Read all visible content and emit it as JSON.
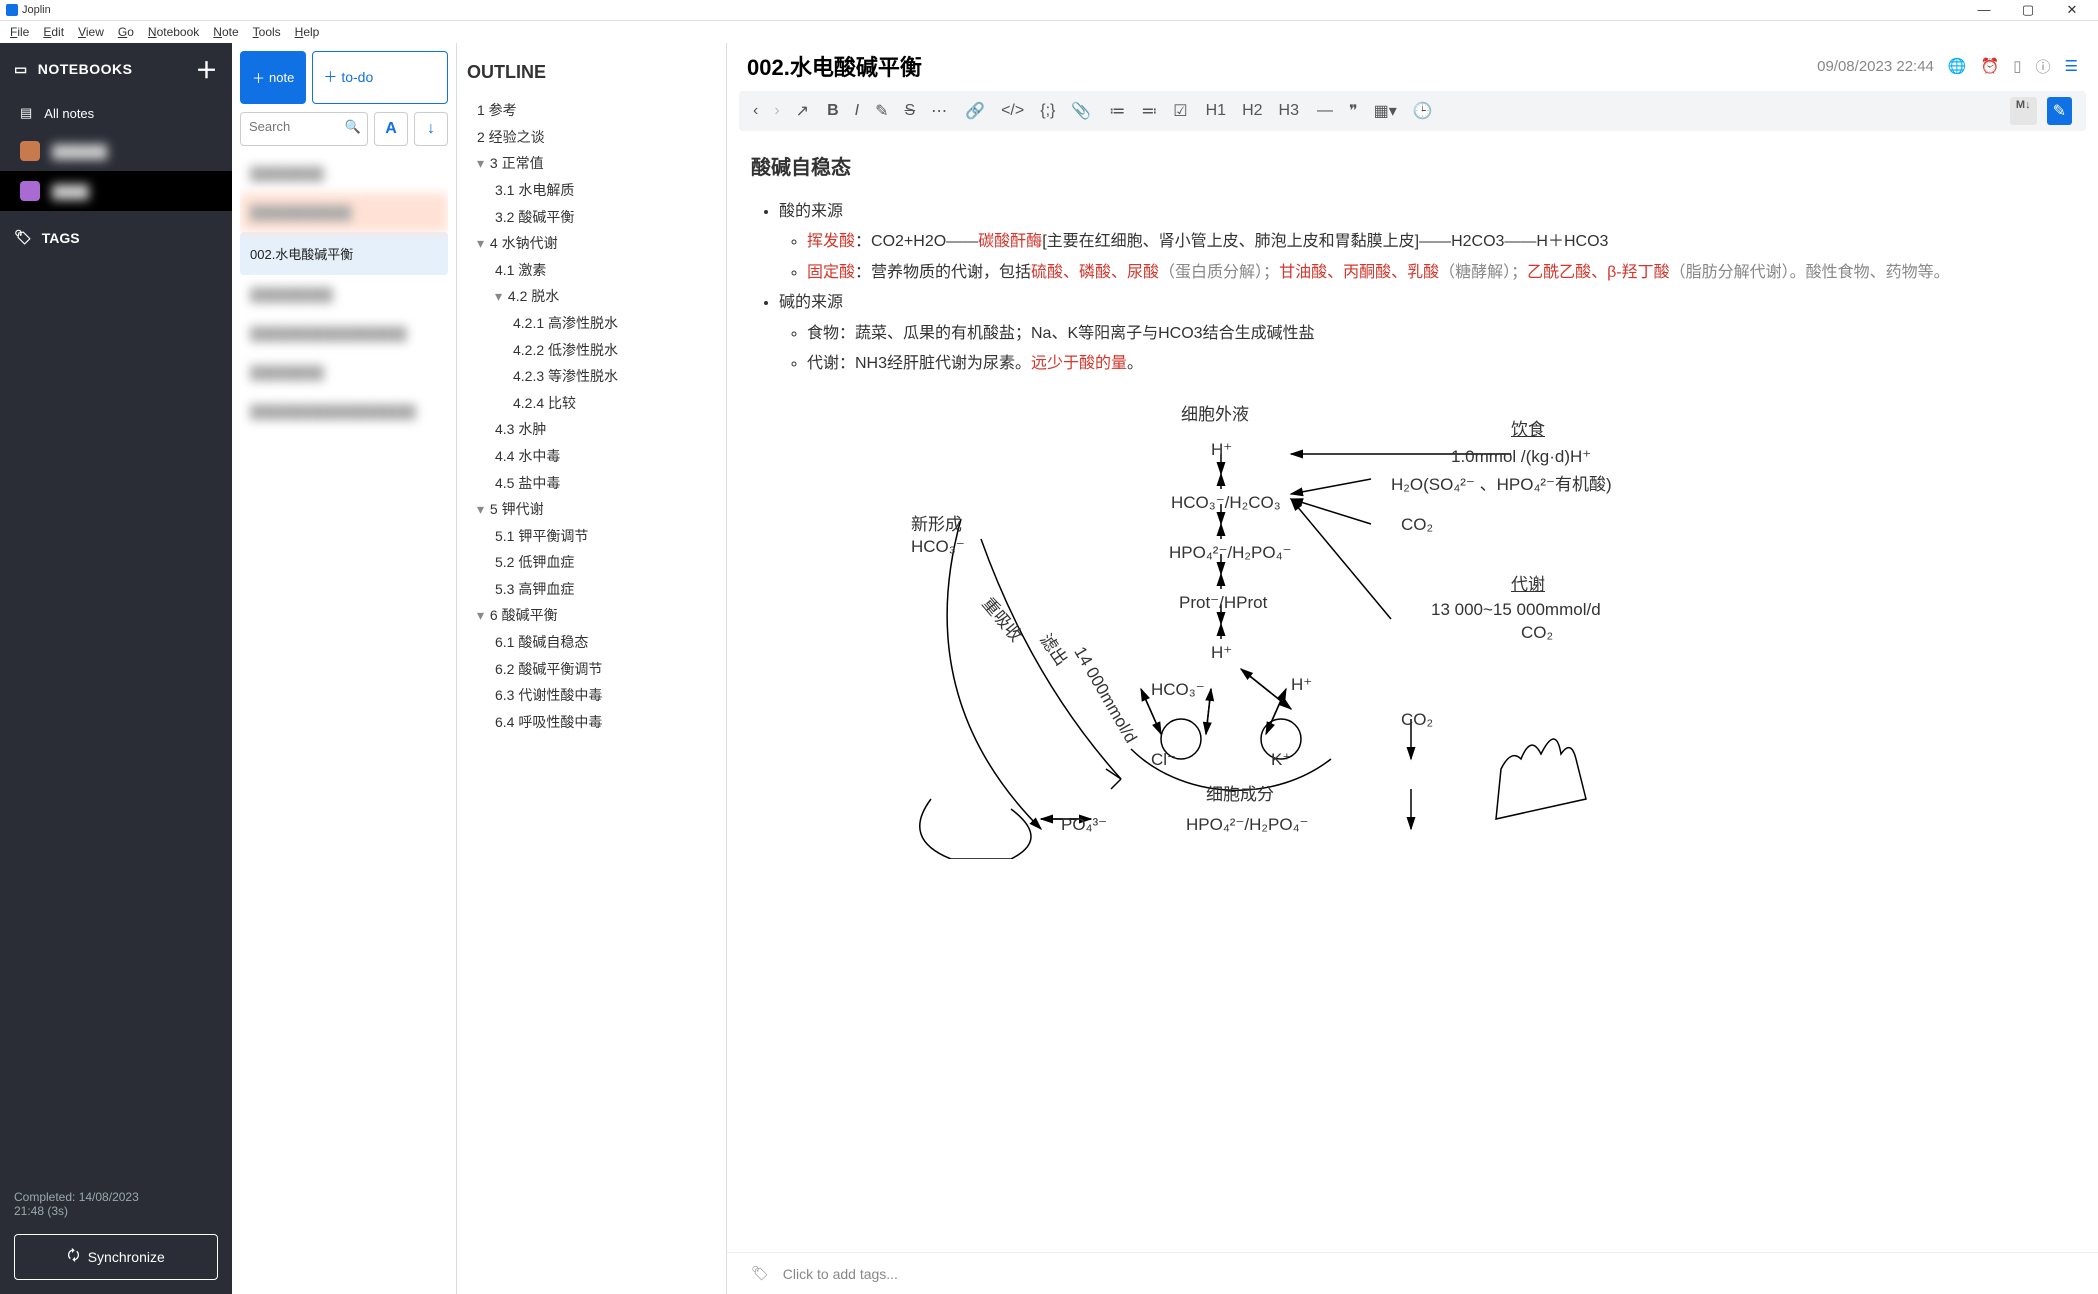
{
  "app": {
    "title": "Joplin"
  },
  "menubar": [
    "File",
    "Edit",
    "View",
    "Go",
    "Notebook",
    "Note",
    "Tools",
    "Help"
  ],
  "window_controls": {
    "min": "—",
    "max": "▢",
    "close": "✕"
  },
  "sidebar": {
    "notebooks_label": "NOTEBOOKS",
    "all_notes": "All notes",
    "nb1": "██████",
    "nb2": "████",
    "tags_label": "TAGS",
    "status_line1": "Completed: 14/08/2023",
    "status_line2": "21:48 (3s)",
    "sync_label": "Synchronize"
  },
  "notelist": {
    "note_btn": "note",
    "todo_btn": "to-do",
    "search_placeholder": "Search",
    "sort_btn": "A",
    "items": [
      {
        "label": "████████",
        "blur": true
      },
      {
        "label": "███████████",
        "blur": true,
        "hl": true
      },
      {
        "label": "002.水电酸碱平衡",
        "sel": true
      },
      {
        "label": "█████████",
        "blur": true
      },
      {
        "label": "█████████████████",
        "blur": true
      },
      {
        "label": "████████",
        "blur": true
      },
      {
        "label": "██████████████████",
        "blur": true
      }
    ]
  },
  "outline": {
    "title": "OUTLINE",
    "items": [
      {
        "indent": 0,
        "tw": "",
        "text": "1 参考"
      },
      {
        "indent": 0,
        "tw": "",
        "text": "2 经验之谈"
      },
      {
        "indent": 0,
        "tw": "▾",
        "text": "3 正常值"
      },
      {
        "indent": 1,
        "tw": "",
        "text": "3.1 水电解质"
      },
      {
        "indent": 1,
        "tw": "",
        "text": "3.2 酸碱平衡"
      },
      {
        "indent": 0,
        "tw": "▾",
        "text": "4 水钠代谢"
      },
      {
        "indent": 1,
        "tw": "",
        "text": "4.1 激素"
      },
      {
        "indent": 1,
        "tw": "▾",
        "text": "4.2 脱水"
      },
      {
        "indent": 2,
        "tw": "",
        "text": "4.2.1 高渗性脱水"
      },
      {
        "indent": 2,
        "tw": "",
        "text": "4.2.2 低渗性脱水"
      },
      {
        "indent": 2,
        "tw": "",
        "text": "4.2.3 等渗性脱水"
      },
      {
        "indent": 2,
        "tw": "",
        "text": "4.2.4 比较"
      },
      {
        "indent": 1,
        "tw": "",
        "text": "4.3 水肿"
      },
      {
        "indent": 1,
        "tw": "",
        "text": "4.4 水中毒"
      },
      {
        "indent": 1,
        "tw": "",
        "text": "4.5 盐中毒"
      },
      {
        "indent": 0,
        "tw": "▾",
        "text": "5 钾代谢"
      },
      {
        "indent": 1,
        "tw": "",
        "text": "5.1 钾平衡调节"
      },
      {
        "indent": 1,
        "tw": "",
        "text": "5.2 低钾血症"
      },
      {
        "indent": 1,
        "tw": "",
        "text": "5.3 高钾血症"
      },
      {
        "indent": 0,
        "tw": "▾",
        "text": "6 酸碱平衡"
      },
      {
        "indent": 1,
        "tw": "",
        "text": "6.1 酸碱自稳态"
      },
      {
        "indent": 1,
        "tw": "",
        "text": "6.2 酸碱平衡调节"
      },
      {
        "indent": 1,
        "tw": "",
        "text": "6.3 代谢性酸中毒"
      },
      {
        "indent": 1,
        "tw": "",
        "text": "6.4 呼吸性酸中毒"
      }
    ]
  },
  "editor": {
    "title": "002.水电酸碱平衡",
    "timestamp": "09/08/2023 22:44",
    "toolbar_h": [
      "H1",
      "H2",
      "H3"
    ],
    "md_label": "M↓"
  },
  "content": {
    "h3": "酸碱自稳态",
    "b1": "酸的来源",
    "line1_a": "挥发酸",
    "line1_b": "：CO2+H2O——",
    "line1_c": "碳酸酐酶",
    "line1_d": "[主要在红细胞、肾小管上皮、肺泡上皮和胃黏膜上皮]——H2CO3——H＋HCO3",
    "line2_a": "固定酸",
    "line2_b": "：营养物质的代谢，包括",
    "line2_c": "硫酸、磷酸、尿酸",
    "line2_d": "（蛋白质分解）；",
    "line2_e": "甘油酸、丙酮酸、乳酸",
    "line2_f": "（糖酵解）；",
    "line2_g": "乙酰乙酸、β-羟丁酸",
    "line2_h": "（脂肪分解代谢）。酸性食物、药物等。",
    "b2": "碱的来源",
    "line3": "食物：蔬菜、瓜果的有机酸盐；Na、K等阳离子与HCO3结合生成碱性盐",
    "line4_a": "代谢：NH3经肝脏代谢为尿素。",
    "line4_b": "远少于酸的量",
    "line4_c": "。"
  },
  "diagram_labels": {
    "ecf": "细胞外液",
    "diet": "饮食",
    "diet_val": "1.0mmol /(kg·d)H⁺",
    "h2o": "H₂O(SO₄²⁻ 、HPO₄²⁻有机酸)",
    "co2a": "CO₂",
    "metab": "代谢",
    "metab_val": "13 000~15 000mmol/d",
    "co2b": "CO₂",
    "co2c": "CO₂",
    "new_hco3": "新形成",
    "new_hco3b": "HCO₃⁻",
    "reabsorb": "重吸收",
    "filter": "滤出",
    "filter_val": "14 000mmol/d",
    "h1": "H⁺",
    "hco3_h2co3": "HCO₃⁻/H₂CO₃",
    "hpo4_h2po4": "HPO₄²⁻/H₂PO₄⁻",
    "prot": "Prot⁻/HProt",
    "h2": "H⁺",
    "h3": "H⁺",
    "k": "K⁺",
    "hco3b": "HCO₃⁻",
    "cl": "Cl⁻",
    "po4": "PO₄³⁻",
    "cell_comp": "细胞成分",
    "hpo4b": "HPO₄²⁻/H₂PO₄⁻"
  },
  "footer": {
    "add_tags": "Click to add tags..."
  }
}
